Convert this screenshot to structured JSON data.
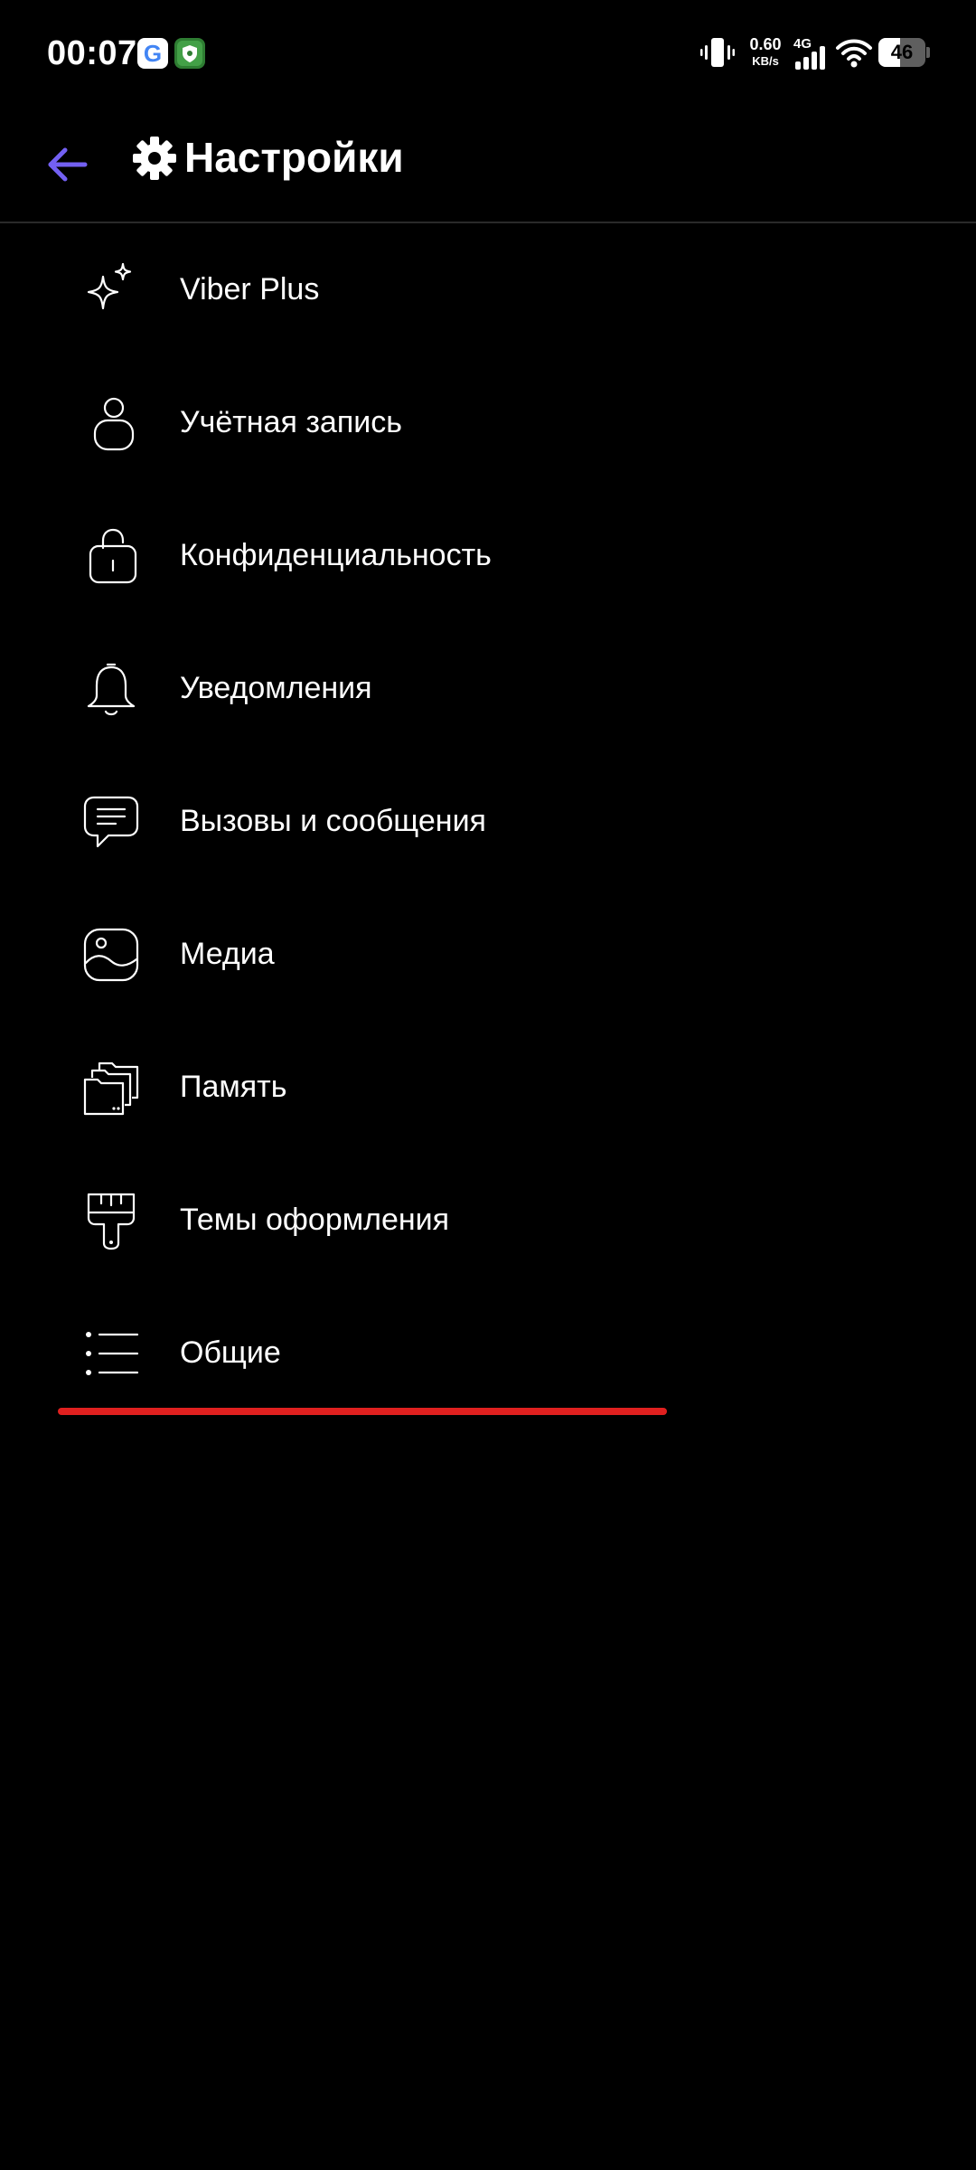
{
  "status_bar": {
    "time": "00:07",
    "notifications": [
      "google-icon",
      "shield-app-icon"
    ],
    "net_speed_value": "0.60",
    "net_speed_unit": "KB/s",
    "network_type": "4G",
    "battery_level": "46",
    "battery_fraction": 0.46,
    "icons": [
      "vibrate-icon",
      "signal-icon",
      "wifi-icon",
      "battery-icon"
    ]
  },
  "app_bar": {
    "back_icon": "arrow-left-icon",
    "title_icon": "gear-icon",
    "title": "Настройки"
  },
  "settings": {
    "items": [
      {
        "icon": "sparkle-icon",
        "label": "Viber Plus"
      },
      {
        "icon": "person-icon",
        "label": "Учётная запись"
      },
      {
        "icon": "lock-icon",
        "label": "Конфиденциальность"
      },
      {
        "icon": "bell-icon",
        "label": "Уведомления"
      },
      {
        "icon": "chat-bubble-icon",
        "label": "Вызовы и сообщения"
      },
      {
        "icon": "image-icon",
        "label": "Медиа"
      },
      {
        "icon": "folders-icon",
        "label": "Память"
      },
      {
        "icon": "paint-brush-icon",
        "label": "Темы оформления"
      },
      {
        "icon": "list-icon",
        "label": "Общие"
      }
    ]
  },
  "colors": {
    "background": "#000000",
    "text": "#ffffff",
    "accent": "#7360f2",
    "highlight_bar": "#e0201f",
    "divider": "#2a2a2a"
  }
}
